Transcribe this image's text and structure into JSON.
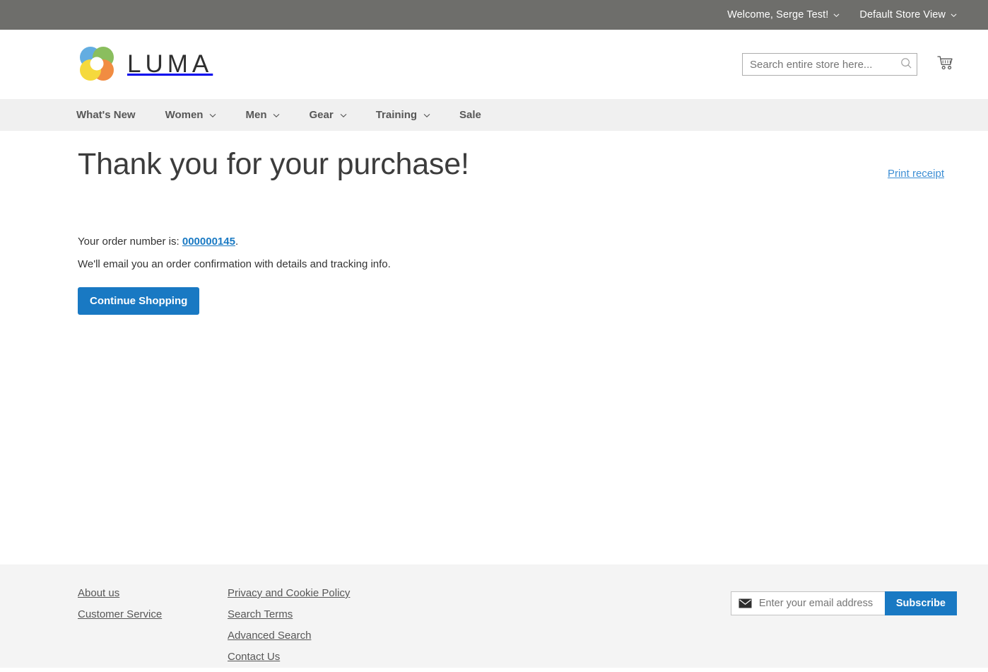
{
  "top_panel": {
    "welcome": "Welcome, Serge Test!",
    "store_view": "Default Store View",
    "chevron_icon": "chevron-down-icon"
  },
  "header": {
    "logo_text": "LUMA",
    "logo_icon": "luma-logo-icon",
    "search": {
      "placeholder": "Search entire store here...",
      "value": "",
      "icon": "search-icon"
    },
    "cart": {
      "icon": "shopping-cart-icon",
      "count": ""
    }
  },
  "nav": {
    "items": [
      {
        "label": "What's New",
        "has_dropdown": false
      },
      {
        "label": "Women",
        "has_dropdown": true
      },
      {
        "label": "Men",
        "has_dropdown": true
      },
      {
        "label": "Gear",
        "has_dropdown": true
      },
      {
        "label": "Training",
        "has_dropdown": true
      },
      {
        "label": "Sale",
        "has_dropdown": false
      }
    ]
  },
  "main": {
    "page_title": "Thank you for your purchase!",
    "print_receipt": "Print receipt",
    "order_label_prefix": "Your order number is: ",
    "order_number": "000000145",
    "order_label_suffix": ".",
    "email_notice": "We'll email you an order confirmation with details and tracking info.",
    "continue_shopping": "Continue Shopping"
  },
  "footer": {
    "column1": [
      {
        "label": "About us"
      },
      {
        "label": "Customer Service"
      }
    ],
    "column2": [
      {
        "label": "Privacy and Cookie Policy"
      },
      {
        "label": "Search Terms"
      },
      {
        "label": "Advanced Search"
      },
      {
        "label": "Contact Us"
      }
    ],
    "newsletter": {
      "icon": "envelope-icon",
      "placeholder": "Enter your email address",
      "value": "",
      "subscribe_label": "Subscribe"
    }
  },
  "colors": {
    "top_panel_bg": "#6e6e6b",
    "nav_bg": "#f0f0f0",
    "footer_bg": "#f4f4f4",
    "accent_blue": "#1979c3",
    "link_blue": "#3d8ed4",
    "text": "#333333"
  }
}
